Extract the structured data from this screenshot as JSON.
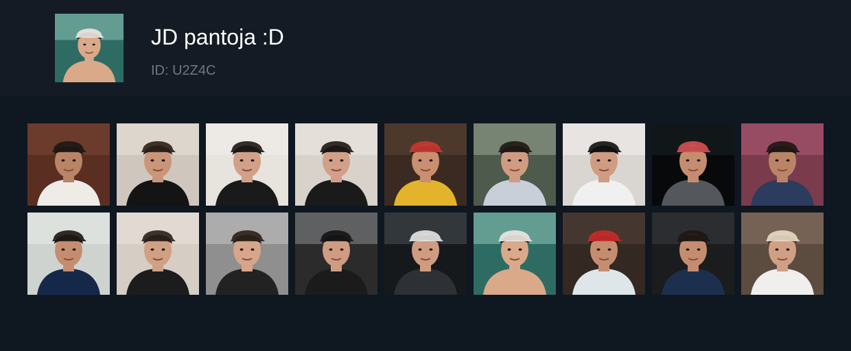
{
  "profile": {
    "name": "JD pantoja :D",
    "id_label": "ID: U2Z4C"
  },
  "avatar": {
    "bg": "#2e6b63",
    "sky": "#8fc7b8",
    "skin": "#d9a98a",
    "hair": "#1e1714",
    "cap": "#ece8e2",
    "shirt": "#d9a98a"
  },
  "photos": [
    {
      "bg": "#5a2f22",
      "sky": "#7a4633",
      "skin": "#b98566",
      "hair": "#1e1714",
      "cap": "#1e1714",
      "shirt": "#efece8"
    },
    {
      "bg": "#cfc7bd",
      "sky": "#e8e2d8",
      "skin": "#c9967a",
      "hair": "#2a201a",
      "cap": "#2a201a",
      "shirt": "#141414"
    },
    {
      "bg": "#e7e3dd",
      "sky": "#f2f0ec",
      "skin": "#d2a088",
      "hair": "#1d1816",
      "cap": "#1d1816",
      "shirt": "#1a1a1a"
    },
    {
      "bg": "#d8d2ca",
      "sky": "#eeeae4",
      "skin": "#d2a088",
      "hair": "#1d1816",
      "cap": "#1d1816",
      "shirt": "#1a1a1a"
    },
    {
      "bg": "#3b2a22",
      "sky": "#5d4334",
      "skin": "#c98f70",
      "hair": "#1a1a1a",
      "cap": "#c8382e",
      "shirt": "#e3b32c"
    },
    {
      "bg": "#4e5a4c",
      "sky": "#9aa893",
      "skin": "#cf9c82",
      "hair": "#1e1714",
      "cap": "#1e1714",
      "shirt": "#c9cfd9"
    },
    {
      "bg": "#d9d6d2",
      "sky": "#f2f0ee",
      "skin": "#cf9c82",
      "hair": "#111111",
      "cap": "#111111",
      "shirt": "#f0f0f0"
    },
    {
      "bg": "#07090b",
      "sky": "#1a2226",
      "skin": "#c58d70",
      "hair": "#1a1a1a",
      "cap": "#d65151",
      "shirt": "#54585d"
    },
    {
      "bg": "#7a3b4d",
      "sky": "#b15b78",
      "skin": "#b98566",
      "hair": "#1e1714",
      "cap": "#1e1714",
      "shirt": "#2b3c5e"
    },
    {
      "bg": "#cfd3cf",
      "sky": "#e9ece9",
      "skin": "#c58d70",
      "hair": "#1e1714",
      "cap": "#1e1714",
      "shirt": "#16284a"
    },
    {
      "bg": "#d6cdc4",
      "sky": "#ece6de",
      "skin": "#d0a085",
      "hair": "#2a201a",
      "cap": "#2a201a",
      "shirt": "#1c1c1c"
    },
    {
      "bg": "#8f8f8f",
      "sky": "#c4c4c4",
      "skin": "#d6a58a",
      "hair": "#2a201a",
      "cap": "#2a201a",
      "shirt": "#222222"
    },
    {
      "bg": "#2b2b2b",
      "sky": "#8a8d8f",
      "skin": "#cf9c82",
      "hair": "#1a1a1a",
      "cap": "#141414",
      "shirt": "#1b1b1b"
    },
    {
      "bg": "#16191c",
      "sky": "#4a5157",
      "skin": "#cf9c82",
      "hair": "#1a1a1a",
      "cap": "#e5e5e5",
      "shirt": "#2d3035"
    },
    {
      "bg": "#2e6b63",
      "sky": "#8fc7b8",
      "skin": "#d9a98a",
      "hair": "#1e1714",
      "cap": "#ece8e2",
      "shirt": "#d9a98a"
    },
    {
      "bg": "#332822",
      "sky": "#54443a",
      "skin": "#c58d70",
      "hair": "#1a1a1a",
      "cap": "#c92a2a",
      "shirt": "#dfe6ea"
    },
    {
      "bg": "#1b1c1e",
      "sky": "#3a3d41",
      "skin": "#c58d70",
      "hair": "#1e1714",
      "cap": "#1e1714",
      "shirt": "#1d2f4f"
    },
    {
      "bg": "#5c4b3f",
      "sky": "#8d7766",
      "skin": "#d0a085",
      "hair": "#3a2a20",
      "cap": "#e8dcc8",
      "shirt": "#f0efed"
    }
  ]
}
